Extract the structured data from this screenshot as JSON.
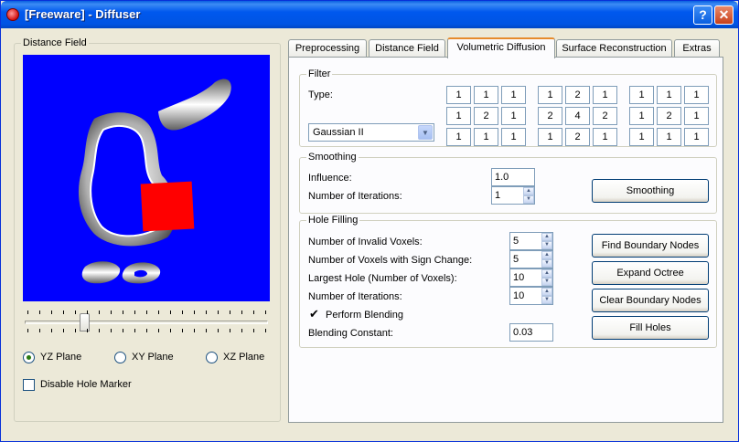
{
  "window": {
    "title": "[Freeware] - Diffuser",
    "help_label": "?",
    "close_label": "✕"
  },
  "distance_field": {
    "group_label": "Distance Field",
    "colors": {
      "background": "#0000ff",
      "marker": "#ff0000"
    },
    "slider": {
      "level": 0.25
    },
    "planes": [
      {
        "label": "YZ Plane",
        "selected": true
      },
      {
        "label": "XY Plane",
        "selected": false
      },
      {
        "label": "XZ Plane",
        "selected": false
      }
    ],
    "disable_hole_marker": {
      "label": "Disable Hole Marker",
      "checked": false
    }
  },
  "tabs": [
    {
      "label": "Preprocessing",
      "active": false
    },
    {
      "label": "Distance Field",
      "active": false
    },
    {
      "label": "Volumetric Diffusion",
      "active": true
    },
    {
      "label": "Surface Reconstruction",
      "active": false
    },
    {
      "label": "Extras",
      "active": false
    }
  ],
  "filter": {
    "group_label": "Filter",
    "type_label": "Type:",
    "type_value": "Gaussian II",
    "kernels": [
      [
        "1",
        "1",
        "1",
        "1",
        "2",
        "1",
        "1",
        "1",
        "1"
      ],
      [
        "1",
        "2",
        "1",
        "2",
        "4",
        "2",
        "1",
        "2",
        "1"
      ],
      [
        "1",
        "1",
        "1",
        "1",
        "2",
        "1",
        "1",
        "1",
        "1"
      ]
    ]
  },
  "smoothing": {
    "group_label": "Smoothing",
    "influence_label": "Influence:",
    "influence_value": "1.0",
    "iterations_label": "Number of Iterations:",
    "iterations_value": "1",
    "button_label": "Smoothing"
  },
  "hole_filling": {
    "group_label": "Hole Filling",
    "invalid_voxels_label": "Number of Invalid Voxels:",
    "invalid_voxels_value": "5",
    "sign_change_label": "Number of Voxels with Sign Change:",
    "sign_change_value": "5",
    "largest_hole_label": "Largest Hole (Number of Voxels):",
    "largest_hole_value": "10",
    "iterations_label": "Number of Iterations:",
    "iterations_value": "10",
    "perform_blending_label": "Perform Blending",
    "perform_blending_checked": true,
    "blending_constant_label": "Blending Constant:",
    "blending_constant_value": "0.03",
    "buttons": {
      "find": "Find Boundary Nodes",
      "expand": "Expand Octree",
      "clear": "Clear Boundary Nodes",
      "fill": "Fill Holes"
    }
  }
}
